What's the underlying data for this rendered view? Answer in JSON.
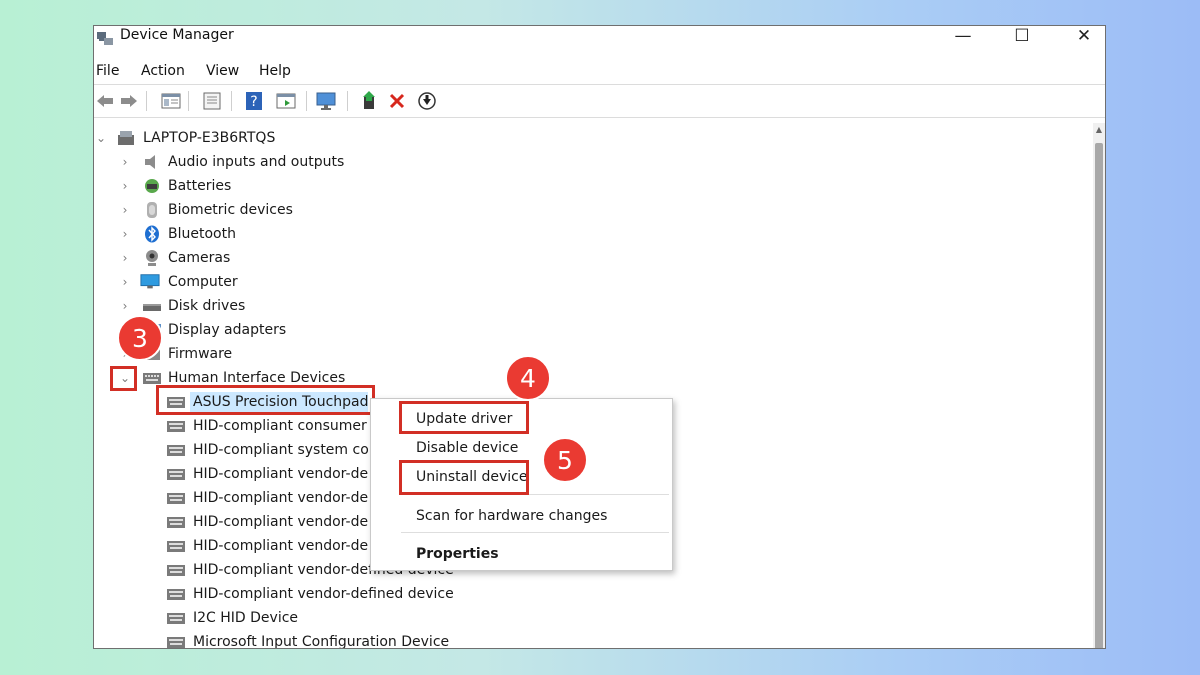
{
  "window": {
    "title": "Device Manager"
  },
  "window_controls": {
    "minimize": "—",
    "maximize": "☐",
    "close": "✕"
  },
  "menu": {
    "file": "File",
    "action": "Action",
    "view": "View",
    "help": "Help"
  },
  "toolbar": {
    "buttons": [
      "back-icon",
      "forward-icon",
      "show-hide-console-tree-icon",
      "properties-icon",
      "help-icon",
      "action-pane-icon",
      "monitor-icon",
      "update-driver-icon",
      "uninstall-icon",
      "scan-hardware-icon"
    ]
  },
  "tree": {
    "root": "LAPTOP-E3B6RTQS",
    "categories": [
      "Audio inputs and outputs",
      "Batteries",
      "Biometric devices",
      "Bluetooth",
      "Cameras",
      "Computer",
      "Disk drives",
      "Display adapters",
      "Firmware",
      "Human Interface Devices"
    ],
    "hid_children": [
      "ASUS Precision Touchpad",
      "HID-compliant consumer",
      "HID-compliant system cor",
      "HID-compliant vendor-de",
      "HID-compliant vendor-de",
      "HID-compliant vendor-de",
      "HID-compliant vendor-de",
      "HID-compliant vendor-defined device",
      "HID-compliant vendor-defined device",
      "I2C HID Device",
      "Microsoft Input Configuration Device"
    ]
  },
  "context_menu": {
    "update_driver": "Update driver",
    "disable_device": "Disable device",
    "uninstall_device": "Uninstall device",
    "scan_hardware": "Scan for hardware changes",
    "properties": "Properties"
  },
  "steps": {
    "step3": "3",
    "step4": "4",
    "step5": "5"
  },
  "colors": {
    "highlight": "#d22f25",
    "badge": "#ea3a32",
    "selection": "#cce8ff"
  }
}
